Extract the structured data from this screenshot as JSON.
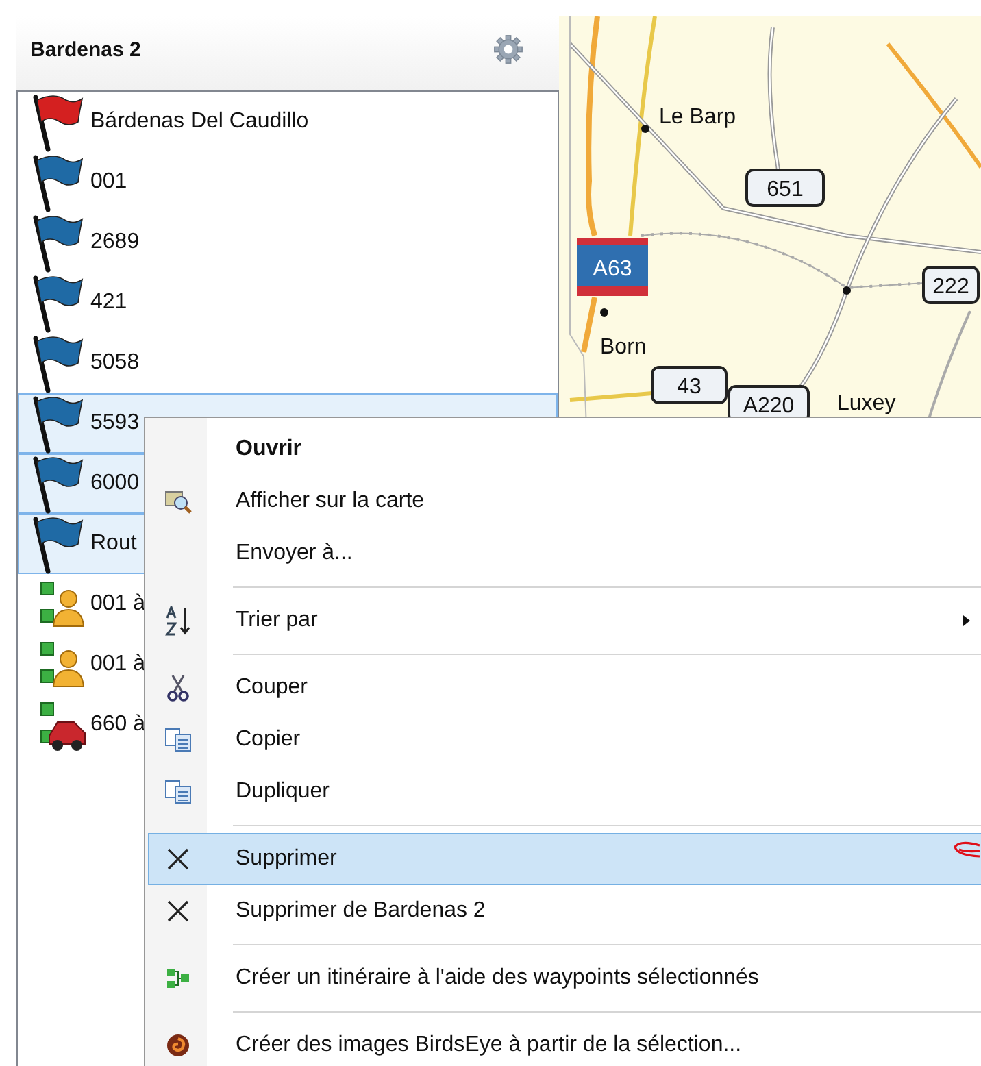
{
  "panel": {
    "title": "Bardenas 2",
    "items": [
      {
        "label": "Bárdenas Del Caudillo",
        "kind": "flag",
        "color": "#d42020",
        "selected": false
      },
      {
        "label": "001",
        "kind": "flag",
        "color": "#1f6aa5",
        "selected": false
      },
      {
        "label": "2689",
        "kind": "flag",
        "color": "#1f6aa5",
        "selected": false
      },
      {
        "label": "421",
        "kind": "flag",
        "color": "#1f6aa5",
        "selected": false
      },
      {
        "label": "5058",
        "kind": "flag",
        "color": "#1f6aa5",
        "selected": false
      },
      {
        "label": "5593",
        "kind": "flag",
        "color": "#1f6aa5",
        "selected": true
      },
      {
        "label": "6000",
        "kind": "flag",
        "color": "#1f6aa5",
        "selected": true
      },
      {
        "label": "Rout",
        "kind": "flag",
        "color": "#1f6aa5",
        "selected": true
      },
      {
        "label": "001 à",
        "kind": "walk-route",
        "selected": false
      },
      {
        "label": "001 à",
        "kind": "walk-route",
        "selected": false
      },
      {
        "label": "660 à",
        "kind": "drive-route",
        "selected": false
      }
    ]
  },
  "map": {
    "labels": [
      {
        "text": "Le Barp",
        "kind": "town"
      },
      {
        "text": "651",
        "kind": "road"
      },
      {
        "text": "A63",
        "kind": "motorway"
      },
      {
        "text": "222",
        "kind": "road"
      },
      {
        "text": "Born",
        "kind": "town"
      },
      {
        "text": "43",
        "kind": "road"
      },
      {
        "text": "A220",
        "kind": "road"
      },
      {
        "text": "Luxey",
        "kind": "town"
      }
    ]
  },
  "context_menu": {
    "groups": [
      [
        {
          "label": "Ouvrir",
          "kind": "open",
          "default": true,
          "selected": false,
          "submenu": false
        },
        {
          "label": "Afficher sur la carte",
          "kind": "show-map",
          "default": false,
          "selected": false,
          "submenu": false
        },
        {
          "label": "Envoyer à...",
          "kind": "send",
          "default": false,
          "selected": false,
          "submenu": false
        }
      ],
      [
        {
          "label": "Trier par",
          "kind": "sort",
          "default": false,
          "selected": false,
          "submenu": true
        }
      ],
      [
        {
          "label": "Couper",
          "kind": "cut",
          "default": false,
          "selected": false,
          "submenu": false
        },
        {
          "label": "Copier",
          "kind": "copy",
          "default": false,
          "selected": false,
          "submenu": false
        },
        {
          "label": "Dupliquer",
          "kind": "duplicate",
          "default": false,
          "selected": false,
          "submenu": false
        }
      ],
      [
        {
          "label": "Supprimer",
          "kind": "delete",
          "default": false,
          "selected": true,
          "submenu": false
        },
        {
          "label": "Supprimer de Bardenas 2",
          "kind": "delete",
          "default": false,
          "selected": false,
          "submenu": false
        }
      ],
      [
        {
          "label": "Créer un itinéraire à l'aide des waypoints sélectionnés",
          "kind": "route",
          "default": false,
          "selected": false,
          "submenu": false
        }
      ],
      [
        {
          "label": "Créer des images BirdsEye à partir de la sélection...",
          "kind": "birdseye",
          "default": false,
          "selected": false,
          "submenu": false
        }
      ]
    ]
  }
}
